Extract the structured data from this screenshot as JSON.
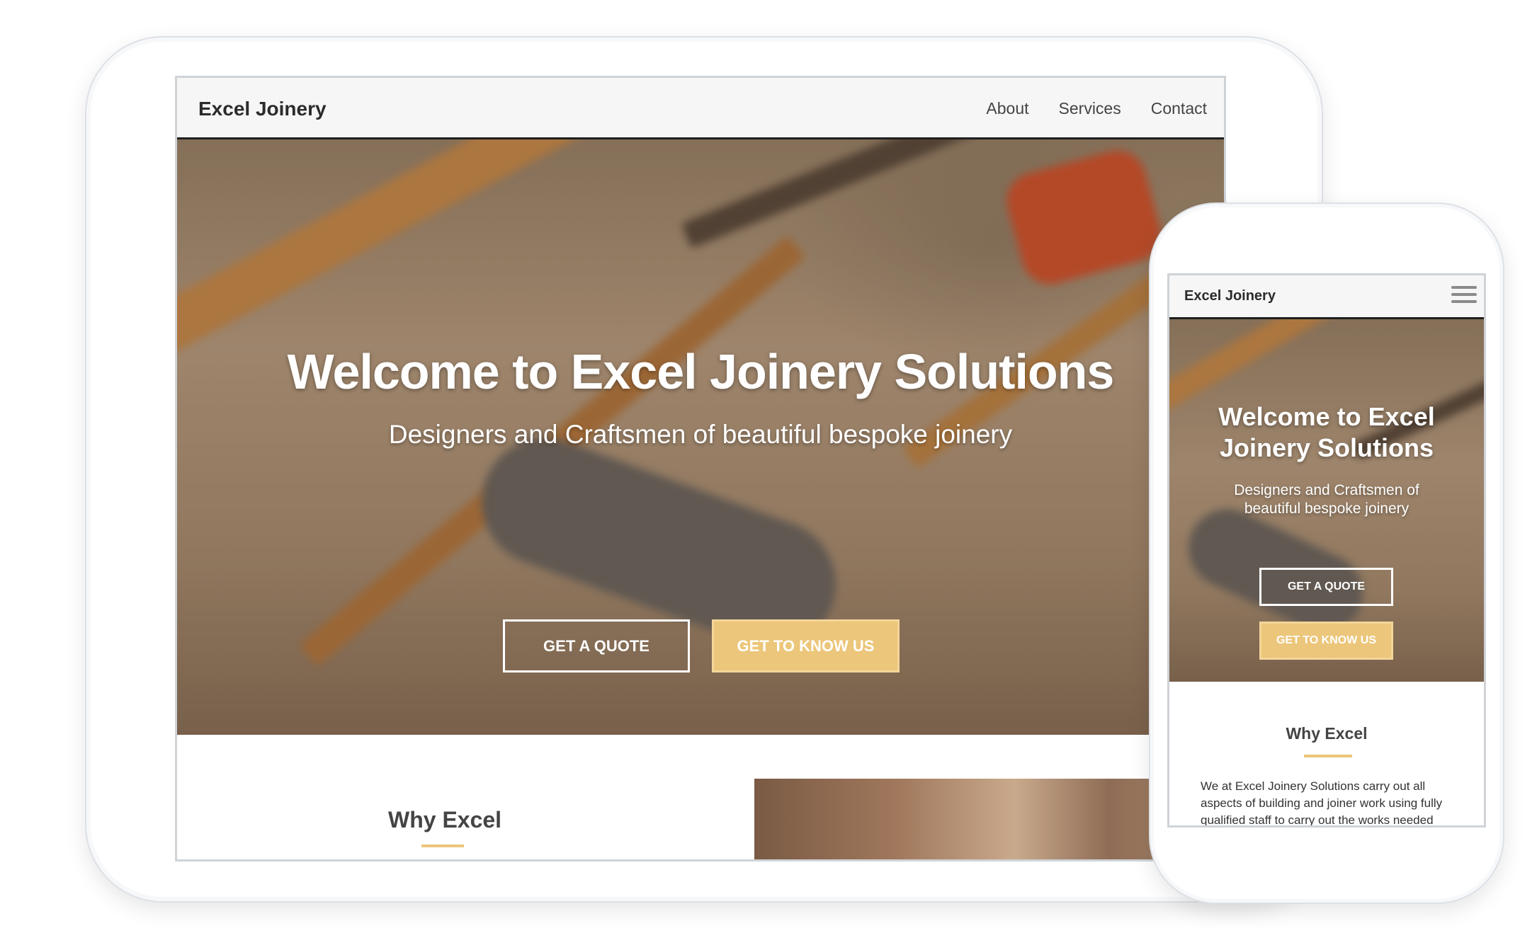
{
  "tablet": {
    "brand": "Excel Joinery",
    "nav": [
      "About",
      "Services",
      "Contact"
    ],
    "hero": {
      "title": "Welcome to Excel Joinery Solutions",
      "subtitle": "Designers and Craftsmen of beautiful bespoke joinery",
      "quote_button": "GET A QUOTE",
      "know_button": "GET TO KNOW US"
    },
    "why_heading": "Why Excel"
  },
  "phone": {
    "brand": "Excel Joinery",
    "hero": {
      "title": "Welcome to Excel Joinery Solutions",
      "subtitle": "Designers and Craftsmen of beautiful bespoke joinery",
      "quote_button": "GET A QUOTE",
      "know_button": "GET TO KNOW US"
    },
    "why_heading": "Why Excel",
    "why_body": "We at Excel Joinery Solutions carry out all aspects of building and joiner work using fully qualified staff to carry out the works needed"
  },
  "icons": {
    "menu": "hamburger-menu-icon"
  },
  "colors": {
    "accent": "#ecc67a",
    "nav_bg": "#f6f6f6",
    "nav_border": "#1f1f1f"
  }
}
